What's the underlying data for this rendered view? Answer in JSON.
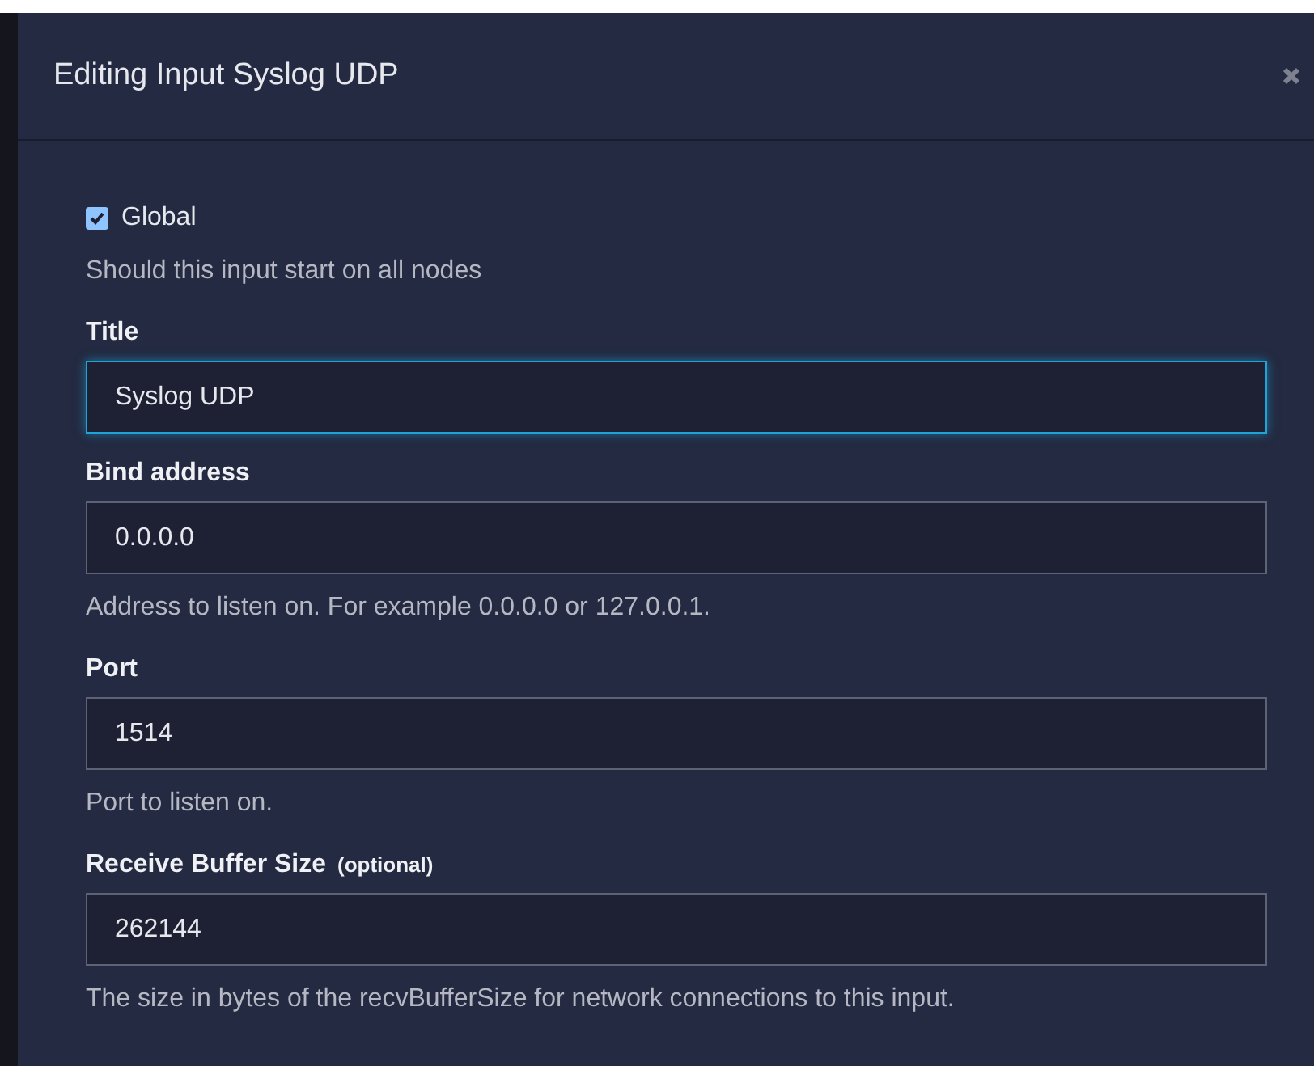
{
  "modal": {
    "title": "Editing Input Syslog UDP"
  },
  "fields": [
    {
      "kind": "checkbox",
      "label": "Global",
      "checked": true,
      "help": "Should this input start on all nodes"
    },
    {
      "kind": "text",
      "label": "Title",
      "value": "Syslog UDP",
      "focused": true
    },
    {
      "kind": "text",
      "label": "Bind address",
      "value": "0.0.0.0",
      "focused": false,
      "help": "Address to listen on. For example 0.0.0.0 or 127.0.0.1."
    },
    {
      "kind": "text",
      "label": "Port",
      "value": "1514",
      "focused": false,
      "help": "Port to listen on."
    },
    {
      "kind": "text",
      "label": "Receive Buffer Size",
      "optional": "(optional)",
      "value": "262144",
      "focused": false,
      "help": "The size in bytes of the recvBufferSize for network connections to this input."
    }
  ]
}
